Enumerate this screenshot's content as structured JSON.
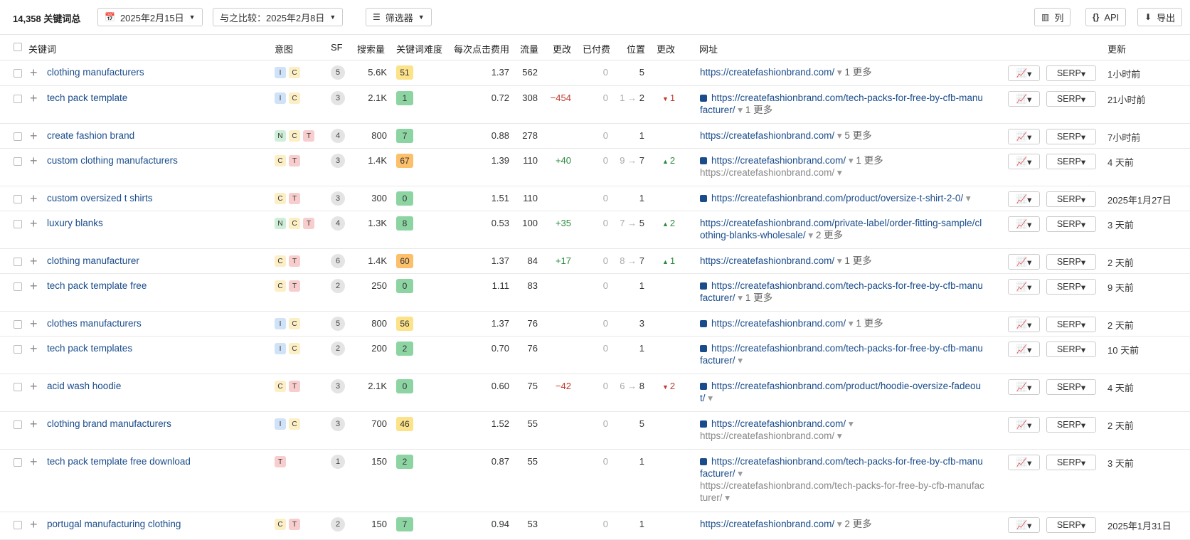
{
  "toolbar": {
    "total": "14,358 关键词总",
    "date": "2025年2月15日",
    "compare_label": "与之比较：",
    "compare_date": "2025年2月8日",
    "filter": "筛选器",
    "columns": "列",
    "api": "API",
    "export": "导出"
  },
  "headers": {
    "keyword": "关键词",
    "intent": "意图",
    "sf": "SF",
    "volume": "搜索量",
    "kd": "关键词难度",
    "cpc": "每次点击费用",
    "traffic": "流量",
    "change": "更改",
    "paid": "已付费",
    "position": "位置",
    "pos_change": "更改",
    "url": "网址",
    "updated": "更新"
  },
  "serp_label": "SERP",
  "kd_colors": {
    "green": "#8dd4a3",
    "yellow": "#fce38a",
    "orange": "#fcbf6b"
  },
  "rows": [
    {
      "keyword": "clothing manufacturers",
      "intents": [
        "I",
        "C"
      ],
      "sf": "5",
      "volume": "5.6K",
      "kd": "51",
      "kd_color": "yellow",
      "cpc": "1.37",
      "traffic": "562",
      "change": "",
      "change_dir": "",
      "paid": "0",
      "pos_from": "",
      "pos_to": "5",
      "pos_change": "",
      "pos_dir": "",
      "url_img": false,
      "url": "https://createfashionbrand.com/",
      "url_more": "1 更多",
      "url_sub": "",
      "updated": "1小时前"
    },
    {
      "keyword": "tech pack template",
      "intents": [
        "I",
        "C"
      ],
      "sf": "3",
      "volume": "2.1K",
      "kd": "1",
      "kd_color": "green",
      "cpc": "0.72",
      "traffic": "308",
      "change": "−454",
      "change_dir": "neg",
      "paid": "0",
      "pos_from": "1",
      "pos_to": "2",
      "pos_change": "1",
      "pos_dir": "down",
      "url_img": true,
      "url": "https://createfashionbrand.com/tech-packs-for-free-by-cfb-manufacturer/",
      "url_more": "1 更多",
      "url_sub": "",
      "updated": "21小时前"
    },
    {
      "keyword": "create fashion brand",
      "intents": [
        "N",
        "C",
        "T"
      ],
      "sf": "4",
      "volume": "800",
      "kd": "7",
      "kd_color": "green",
      "cpc": "0.88",
      "traffic": "278",
      "change": "",
      "change_dir": "",
      "paid": "0",
      "pos_from": "",
      "pos_to": "1",
      "pos_change": "",
      "pos_dir": "",
      "url_img": false,
      "url": "https://createfashionbrand.com/",
      "url_more": "5 更多",
      "url_sub": "",
      "updated": "7小时前"
    },
    {
      "keyword": "custom clothing manufacturers",
      "intents": [
        "C",
        "T"
      ],
      "sf": "3",
      "volume": "1.4K",
      "kd": "67",
      "kd_color": "orange",
      "cpc": "1.39",
      "traffic": "110",
      "change": "+40",
      "change_dir": "pos",
      "paid": "0",
      "pos_from": "9",
      "pos_to": "7",
      "pos_change": "2",
      "pos_dir": "up",
      "url_img": true,
      "url": "https://createfashionbrand.com/",
      "url_more": "1 更多",
      "url_sub": "https://createfashionbrand.com/",
      "updated": "4 天前"
    },
    {
      "keyword": "custom oversized t shirts",
      "intents": [
        "C",
        "T"
      ],
      "sf": "3",
      "volume": "300",
      "kd": "0",
      "kd_color": "green",
      "cpc": "1.51",
      "traffic": "110",
      "change": "",
      "change_dir": "",
      "paid": "0",
      "pos_from": "",
      "pos_to": "1",
      "pos_change": "",
      "pos_dir": "",
      "url_img": true,
      "url": "https://createfashionbrand.com/product/oversize-t-shirt-2-0/",
      "url_more": "",
      "url_sub": "",
      "updated": "2025年1月27日"
    },
    {
      "keyword": "luxury blanks",
      "intents": [
        "N",
        "C",
        "T"
      ],
      "sf": "4",
      "volume": "1.3K",
      "kd": "8",
      "kd_color": "green",
      "cpc": "0.53",
      "traffic": "100",
      "change": "+35",
      "change_dir": "pos",
      "paid": "0",
      "pos_from": "7",
      "pos_to": "5",
      "pos_change": "2",
      "pos_dir": "up",
      "url_img": false,
      "url": "https://createfashionbrand.com/private-label/order-fitting-sample/clothing-blanks-wholesale/",
      "url_more": "2 更多",
      "url_sub": "",
      "updated": "3 天前"
    },
    {
      "keyword": "clothing manufacturer",
      "intents": [
        "C",
        "T"
      ],
      "sf": "6",
      "volume": "1.4K",
      "kd": "60",
      "kd_color": "orange",
      "cpc": "1.37",
      "traffic": "84",
      "change": "+17",
      "change_dir": "pos",
      "paid": "0",
      "pos_from": "8",
      "pos_to": "7",
      "pos_change": "1",
      "pos_dir": "up",
      "url_img": false,
      "url": "https://createfashionbrand.com/",
      "url_more": "1 更多",
      "url_sub": "",
      "updated": "2 天前"
    },
    {
      "keyword": "tech pack template free",
      "intents": [
        "C",
        "T"
      ],
      "sf": "2",
      "volume": "250",
      "kd": "0",
      "kd_color": "green",
      "cpc": "1.11",
      "traffic": "83",
      "change": "",
      "change_dir": "",
      "paid": "0",
      "pos_from": "",
      "pos_to": "1",
      "pos_change": "",
      "pos_dir": "",
      "url_img": true,
      "url": "https://createfashionbrand.com/tech-packs-for-free-by-cfb-manufacturer/",
      "url_more": "1 更多",
      "url_sub": "",
      "updated": "9 天前"
    },
    {
      "keyword": "clothes manufacturers",
      "intents": [
        "I",
        "C"
      ],
      "sf": "5",
      "volume": "800",
      "kd": "56",
      "kd_color": "yellow",
      "cpc": "1.37",
      "traffic": "76",
      "change": "",
      "change_dir": "",
      "paid": "0",
      "pos_from": "",
      "pos_to": "3",
      "pos_change": "",
      "pos_dir": "",
      "url_img": true,
      "url": "https://createfashionbrand.com/",
      "url_more": "1 更多",
      "url_sub": "",
      "updated": "2 天前"
    },
    {
      "keyword": "tech pack templates",
      "intents": [
        "I",
        "C"
      ],
      "sf": "2",
      "volume": "200",
      "kd": "2",
      "kd_color": "green",
      "cpc": "0.70",
      "traffic": "76",
      "change": "",
      "change_dir": "",
      "paid": "0",
      "pos_from": "",
      "pos_to": "1",
      "pos_change": "",
      "pos_dir": "",
      "url_img": true,
      "url": "https://createfashionbrand.com/tech-packs-for-free-by-cfb-manufacturer/",
      "url_more": "",
      "url_sub": "",
      "updated": "10 天前"
    },
    {
      "keyword": "acid wash hoodie",
      "intents": [
        "C",
        "T"
      ],
      "sf": "3",
      "volume": "2.1K",
      "kd": "0",
      "kd_color": "green",
      "cpc": "0.60",
      "traffic": "75",
      "change": "−42",
      "change_dir": "neg",
      "paid": "0",
      "pos_from": "6",
      "pos_to": "8",
      "pos_change": "2",
      "pos_dir": "down",
      "url_img": true,
      "url": "https://createfashionbrand.com/product/hoodie-oversize-fadeout/",
      "url_more": "",
      "url_sub": "",
      "updated": "4 天前"
    },
    {
      "keyword": "clothing brand manufacturers",
      "intents": [
        "I",
        "C"
      ],
      "sf": "3",
      "volume": "700",
      "kd": "46",
      "kd_color": "yellow",
      "cpc": "1.52",
      "traffic": "55",
      "change": "",
      "change_dir": "",
      "paid": "0",
      "pos_from": "",
      "pos_to": "5",
      "pos_change": "",
      "pos_dir": "",
      "url_img": true,
      "url": "https://createfashionbrand.com/",
      "url_more": "",
      "url_sub": "https://createfashionbrand.com/",
      "updated": "2 天前"
    },
    {
      "keyword": "tech pack template free download",
      "intents": [
        "T"
      ],
      "sf": "1",
      "volume": "150",
      "kd": "2",
      "kd_color": "green",
      "cpc": "0.87",
      "traffic": "55",
      "change": "",
      "change_dir": "",
      "paid": "0",
      "pos_from": "",
      "pos_to": "1",
      "pos_change": "",
      "pos_dir": "",
      "url_img": true,
      "url": "https://createfashionbrand.com/tech-packs-for-free-by-cfb-manufacturer/",
      "url_more": "",
      "url_sub": "https://createfashionbrand.com/tech-packs-for-free-by-cfb-manufacturer/",
      "updated": "3 天前"
    },
    {
      "keyword": "portugal manufacturing clothing",
      "intents": [
        "C",
        "T"
      ],
      "sf": "2",
      "volume": "150",
      "kd": "7",
      "kd_color": "green",
      "cpc": "0.94",
      "traffic": "53",
      "change": "",
      "change_dir": "",
      "paid": "0",
      "pos_from": "",
      "pos_to": "1",
      "pos_change": "",
      "pos_dir": "",
      "url_img": false,
      "url": "https://createfashionbrand.com/",
      "url_more": "2 更多",
      "url_sub": "",
      "updated": "2025年1月31日"
    }
  ]
}
